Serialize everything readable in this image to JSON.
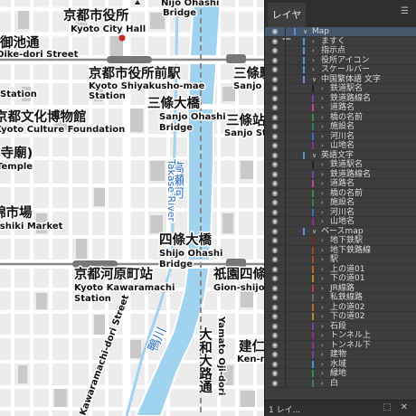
{
  "map": {
    "labels_ja": {
      "city_hall": "京都市役所",
      "nijo": "Nijo Ohashi",
      "oike": "御池通",
      "shiyakusho_station": "京都市役所前駅",
      "sanjo_station": "三條駅",
      "sanjo_ohashi": "三條大橋",
      "sanjo_sta2": "三條站",
      "bunka": "京都文化博物館",
      "temple": "(寺廟)",
      "takase_ja": "高瀬河",
      "market": "錦市場",
      "shijo_ohashi": "四條大橋",
      "kawaramachi_station": "京都河原町站",
      "gion_station": "祇園四條",
      "yamato": "大和大路通",
      "kamo_ja": "鴨川",
      "kennin": "建仁"
    },
    "labels_en": {
      "city_hall": "Kyoto City Hall",
      "nijo_bridge": "Bridge",
      "oike": "Oike-dori Street",
      "shiyakusho": "Kyoto Shiyakusho-mae",
      "shiyakusho_station": "Station",
      "sanjo": "Sanjo",
      "sanjo_station_en": "Sanjo St",
      "sanjo_ohashi": "Sanjo Ohashi",
      "bridge": "Bridge",
      "bunka": "Kyoto Culture Foundation",
      "temple": "Temple",
      "takase": "Takase River",
      "market": "Nishiki Market",
      "shijo_ohashi": "Shijo Ohashi",
      "kawaramachi": "Kyoto Kawaramachi",
      "station": "Station",
      "gion": "Gion-shijo",
      "yamato": "Yamato Oji-dori",
      "kawaramachi_dori": "Kawaramachi-dori Street",
      "kenmin": "Ken-n"
    }
  },
  "panel": {
    "tab_label": "レイヤー",
    "menu_icon": "menu-icon",
    "footer_label": "1 レイ...",
    "footer_icons": [
      "new-layer-icon",
      "delete-icon"
    ],
    "layers": [
      {
        "name": "Map",
        "color": "#5b8fd6",
        "depth": 0,
        "open": true,
        "selected": true
      },
      {
        "name": "ますく",
        "color": "#5b8fd6",
        "depth": 1,
        "open": false
      },
      {
        "name": "指示点",
        "color": "#5b8fd6",
        "depth": 1,
        "open": false
      },
      {
        "name": "役所アイコン",
        "color": "#5b8fd6",
        "depth": 1,
        "open": false
      },
      {
        "name": "スケールバー",
        "color": "#5b8fd6",
        "depth": 1,
        "open": false
      },
      {
        "name": "中国繁体語 文字",
        "color": "#5b8fd6",
        "depth": 1,
        "open": true
      },
      {
        "name": "鉄道駅名",
        "color": "#222222",
        "depth": 2,
        "open": false
      },
      {
        "name": "鉄道路線名",
        "color": "#7a3fa8",
        "depth": 2,
        "open": false
      },
      {
        "name": "道路名",
        "color": "#c2459a",
        "depth": 2,
        "open": false
      },
      {
        "name": "橋の名前",
        "color": "#3b8f45",
        "depth": 2,
        "open": false
      },
      {
        "name": "施設名",
        "color": "#2e7d4f",
        "depth": 2,
        "open": false
      },
      {
        "name": "河川名",
        "color": "#3a6fc9",
        "depth": 2,
        "open": false
      },
      {
        "name": "山地名",
        "color": "#8e2f8f",
        "depth": 2,
        "open": false
      },
      {
        "name": "英語文字",
        "color": "#5b8fd6",
        "depth": 1,
        "open": true
      },
      {
        "name": "鉄道駅名",
        "color": "#222222",
        "depth": 2,
        "open": false
      },
      {
        "name": "鉄道路線名",
        "color": "#7a3fa8",
        "depth": 2,
        "open": false
      },
      {
        "name": "道路名",
        "color": "#c2459a",
        "depth": 2,
        "open": false
      },
      {
        "name": "橋の名前",
        "color": "#3b8f45",
        "depth": 2,
        "open": false
      },
      {
        "name": "施設名",
        "color": "#2e7d4f",
        "depth": 2,
        "open": false
      },
      {
        "name": "河川名",
        "color": "#3a6fc9",
        "depth": 2,
        "open": false
      },
      {
        "name": "山地名",
        "color": "#8e2f8f",
        "depth": 2,
        "open": false
      },
      {
        "name": "ベースmap",
        "color": "#5b8fd6",
        "depth": 1,
        "open": true
      },
      {
        "name": "地下鉄駅",
        "color": "#8a1d1d",
        "depth": 2,
        "open": false
      },
      {
        "name": "地下鉄路線",
        "color": "#9a4d22",
        "depth": 2,
        "open": false
      },
      {
        "name": "駅",
        "color": "#a04a2a",
        "depth": 2,
        "open": false
      },
      {
        "name": "上の道01",
        "color": "#b86a2a",
        "depth": 2,
        "open": false
      },
      {
        "name": "下の道01",
        "color": "#b58a2a",
        "depth": 2,
        "open": false
      },
      {
        "name": "JR線路",
        "color": "#c23c3c",
        "depth": 2,
        "open": false
      },
      {
        "name": "私鉄線路",
        "color": "#6a6a6a",
        "depth": 2,
        "open": false
      },
      {
        "name": "上の道02",
        "color": "#b86a2a",
        "depth": 2,
        "open": false
      },
      {
        "name": "下の道02",
        "color": "#b58a2a",
        "depth": 2,
        "open": false
      },
      {
        "name": "石段",
        "color": "#7a3fa8",
        "depth": 2,
        "open": false
      },
      {
        "name": "トンネル上",
        "color": "#8e2f8f",
        "depth": 2,
        "open": false
      },
      {
        "name": "トンネル下",
        "color": "#8e2f8f",
        "depth": 2,
        "open": false
      },
      {
        "name": "建物",
        "color": "#7a3fa8",
        "depth": 2,
        "open": false
      },
      {
        "name": "水域",
        "color": "#3a9ad9",
        "depth": 2,
        "open": false
      },
      {
        "name": "緑地",
        "color": "#3b8f45",
        "depth": 2,
        "open": false
      },
      {
        "name": "白",
        "color": "#3a7f4a",
        "depth": 2,
        "open": false
      }
    ]
  }
}
